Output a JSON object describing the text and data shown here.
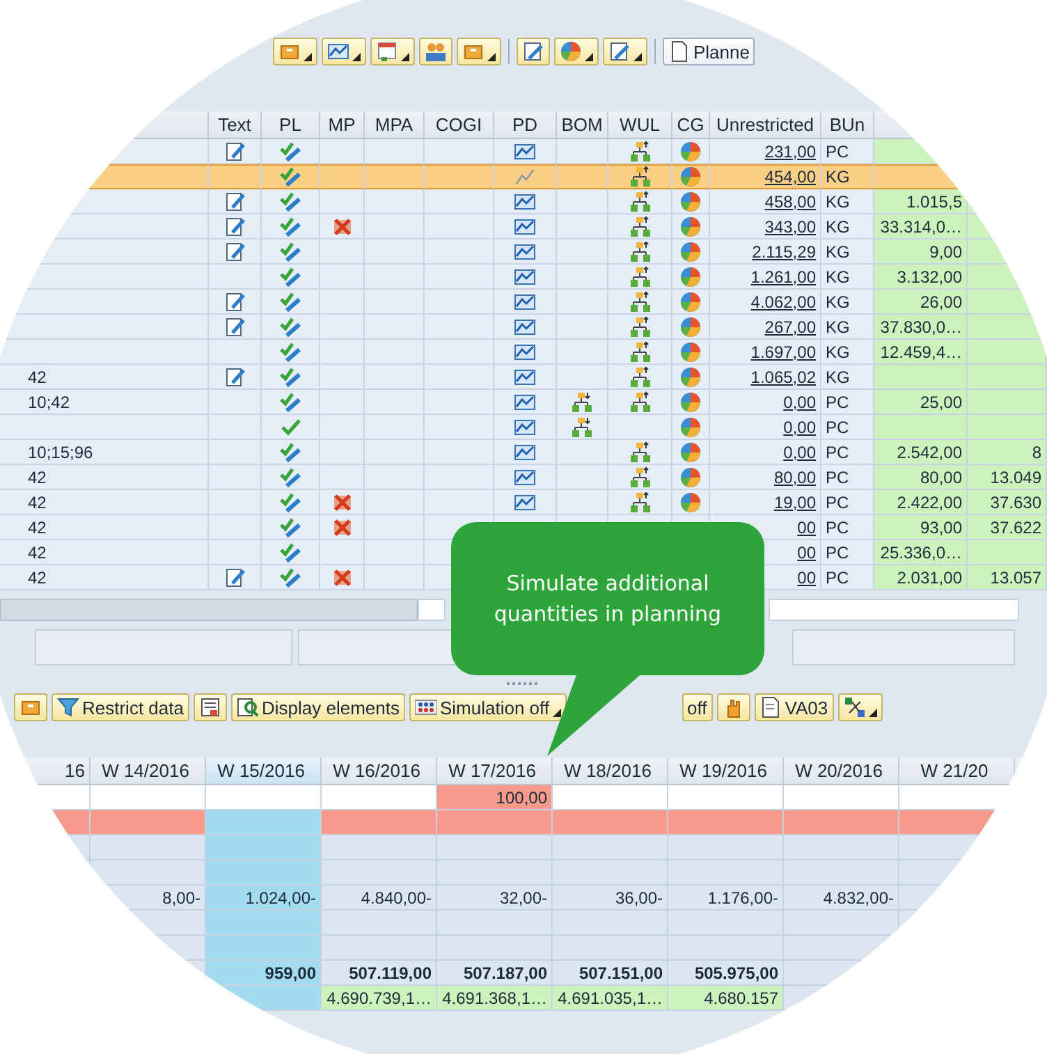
{
  "toolbar": {
    "buttons": [
      {
        "kind": "icon",
        "dropdown": true
      },
      {
        "kind": "icon",
        "dropdown": true
      },
      {
        "kind": "icon",
        "dropdown": true
      },
      {
        "kind": "icon",
        "dropdown": false
      },
      {
        "kind": "icon",
        "dropdown": true
      },
      {
        "kind": "separator"
      },
      {
        "kind": "icon",
        "dropdown": false
      },
      {
        "kind": "icon",
        "dropdown": true
      },
      {
        "kind": "icon",
        "dropdown": true
      },
      {
        "kind": "separator"
      },
      {
        "kind": "text",
        "label": "Planne",
        "dropdown": false
      }
    ]
  },
  "stock_table": {
    "columns": [
      "Text",
      "PL",
      "MP",
      "MPA",
      "COGI",
      "PD",
      "BOM",
      "WUL",
      "CG",
      "Unrestricted",
      "BUn"
    ],
    "rows": [
      {
        "selected": false,
        "text": true,
        "pl_edit": true,
        "mp": false,
        "pd_active": true,
        "bom": false,
        "wul": true,
        "cg": true,
        "unrestricted": "231,00",
        "unit": "PC"
      },
      {
        "selected": true,
        "text": false,
        "pl_edit": true,
        "mp": false,
        "pd_active": false,
        "bom": false,
        "wul": true,
        "cg": true,
        "unrestricted": "454,00",
        "unit": "KG"
      },
      {
        "selected": false,
        "text": true,
        "pl_edit": true,
        "mp": false,
        "pd_active": true,
        "bom": false,
        "wul": true,
        "cg": true,
        "unrestricted": "458,00",
        "unit": "KG",
        "column_13": "1.015,5"
      },
      {
        "selected": false,
        "text": true,
        "pl_edit": true,
        "mp": true,
        "pd_active": true,
        "bom": false,
        "wul": true,
        "cg": true,
        "unrestricted": "343,00",
        "unit": "KG",
        "column_13": "33.314,0…"
      },
      {
        "selected": false,
        "text": true,
        "pl_edit": true,
        "mp": false,
        "pd_active": true,
        "bom": false,
        "wul": true,
        "cg": true,
        "unrestricted": "2.115,29",
        "unit": "KG",
        "column_13": "9,00"
      },
      {
        "selected": false,
        "text": false,
        "pl_edit": true,
        "mp": false,
        "pd_active": true,
        "bom": false,
        "wul": true,
        "cg": true,
        "unrestricted": "1.261,00",
        "unit": "KG",
        "column_13": "3.132,00"
      },
      {
        "selected": false,
        "text": true,
        "pl_edit": true,
        "mp": false,
        "pd_active": true,
        "bom": false,
        "wul": true,
        "cg": true,
        "unrestricted": "4.062,00",
        "unit": "KG",
        "column_13": "26,00"
      },
      {
        "selected": false,
        "text": true,
        "pl_edit": true,
        "mp": false,
        "pd_active": true,
        "bom": false,
        "wul": true,
        "cg": true,
        "unrestricted": "267,00",
        "unit": "KG",
        "column_13": "37.830,0…"
      },
      {
        "selected": false,
        "text": false,
        "pl_edit": true,
        "mp": false,
        "pd_active": true,
        "bom": false,
        "wul": true,
        "cg": true,
        "unrestricted": "1.697,00",
        "unit": "KG",
        "column_13": "12.459,4…"
      },
      {
        "selected": false,
        "description": "42",
        "text": true,
        "pl_edit": true,
        "mp": false,
        "pd_active": true,
        "bom": false,
        "wul": true,
        "cg": true,
        "unrestricted": "1.065,02",
        "unit": "KG"
      },
      {
        "selected": false,
        "description": "10;42",
        "text": false,
        "pl_edit": true,
        "mp": false,
        "pd_active": true,
        "bom": true,
        "wul": true,
        "cg": true,
        "unrestricted": "0,00",
        "unit": "PC",
        "column_13": "25,00"
      },
      {
        "selected": false,
        "text": false,
        "pl_edit": false,
        "mp": false,
        "pd_active": true,
        "bom": true,
        "wul": false,
        "cg": true,
        "unrestricted": "0,00",
        "unit": "PC"
      },
      {
        "selected": false,
        "description": "10;15;96",
        "text": false,
        "pl_edit": true,
        "mp": false,
        "pd_active": true,
        "bom": false,
        "wul": true,
        "cg": true,
        "unrestricted": "0,00",
        "unit": "PC",
        "column_13": "2.542,00",
        "column_14": "8"
      },
      {
        "selected": false,
        "description": "42",
        "text": false,
        "pl_edit": true,
        "mp": false,
        "pd_active": true,
        "bom": false,
        "wul": true,
        "cg": true,
        "unrestricted": "80,00",
        "unit": "PC",
        "column_13": "80,00",
        "column_14": "13.049"
      },
      {
        "selected": false,
        "description": "42",
        "text": false,
        "pl_edit": true,
        "mp": true,
        "pd_active": true,
        "bom": false,
        "wul": true,
        "cg": true,
        "unrestricted": "19,00",
        "unit": "PC",
        "column_13": "2.422,00",
        "column_14": "37.630"
      },
      {
        "selected": false,
        "description": "42",
        "text": false,
        "pl_edit": true,
        "mp": true,
        "unrestricted": "00",
        "unit": "PC",
        "column_13": "93,00",
        "column_14": "37.622"
      },
      {
        "selected": false,
        "description": "42",
        "text": false,
        "pl_edit": true,
        "mp": false,
        "unrestricted": "00",
        "unit": "PC",
        "column_13": "25.336,0…"
      },
      {
        "selected": false,
        "description": "42",
        "text": true,
        "pl_edit": true,
        "mp": true,
        "unrestricted": "00",
        "unit": "PC",
        "column_13": "2.031,00",
        "column_14": "13.057"
      }
    ]
  },
  "planning_toolbar": {
    "buttons": [
      {
        "kind": "icon",
        "dropdown": false
      },
      {
        "kind": "text",
        "label": "Restrict data",
        "dropdown": false
      },
      {
        "kind": "icon",
        "dropdown": false
      },
      {
        "kind": "text",
        "label": "Display elements",
        "dropdown": false
      },
      {
        "kind": "text",
        "label": "Simulation off",
        "dropdown": true
      },
      {
        "kind": "text",
        "label": "off",
        "dropdown": false
      },
      {
        "kind": "icon",
        "dropdown": false
      },
      {
        "kind": "text",
        "label": "VA03",
        "dropdown": false
      },
      {
        "kind": "icon",
        "dropdown": true
      }
    ]
  },
  "periods": [
    {
      "label": "16",
      "selected": false
    },
    {
      "label": "W 14/2016",
      "selected": false
    },
    {
      "label": "W 15/2016",
      "selected": true
    },
    {
      "label": "W 16/2016",
      "selected": false
    },
    {
      "label": "W 17/2016",
      "selected": false
    },
    {
      "label": "W 18/2016",
      "selected": false
    },
    {
      "label": "W 19/2016",
      "selected": false
    },
    {
      "label": "W 20/2016",
      "selected": false
    },
    {
      "label": "W 21/20",
      "selected": false
    }
  ],
  "period_rows": [
    {
      "kind": "simulation",
      "cells": [
        "",
        "",
        "",
        "",
        "100,00",
        "",
        "",
        "",
        ""
      ]
    },
    {
      "kind": "shortage",
      "cells": [
        "",
        "",
        "",
        "",
        "",
        "",
        "",
        "",
        ""
      ]
    },
    {
      "kind": "plain",
      "cells": [
        "",
        "",
        "",
        "",
        "",
        "",
        "",
        "",
        ""
      ]
    },
    {
      "kind": "plain",
      "cells": [
        "",
        "",
        "",
        "",
        "",
        "",
        "",
        "",
        ""
      ]
    },
    {
      "kind": "plain",
      "cells": [
        "",
        "8,00-",
        "1.024,00-",
        "4.840,00-",
        "32,00-",
        "36,00-",
        "1.176,00-",
        "4.832,00-",
        ""
      ]
    },
    {
      "kind": "plain",
      "cells": [
        "",
        "",
        "",
        "",
        "",
        "",
        "",
        "",
        ""
      ]
    },
    {
      "kind": "plain",
      "cells": [
        "",
        "",
        "",
        "",
        "",
        "",
        "",
        "",
        ""
      ]
    },
    {
      "kind": "total",
      "cells": [
        "",
        "",
        "959,00",
        "507.119,00",
        "507.187,00",
        "507.151,00",
        "505.975,00",
        "",
        ""
      ]
    },
    {
      "kind": "cumulative",
      "cells": [
        "",
        "",
        "",
        "4.690.739,1…",
        "4.691.368,1…",
        "4.691.035,1…",
        "4.680.157",
        "",
        ""
      ]
    }
  ],
  "callout": {
    "text": "Simulate additional quantities in planning"
  }
}
